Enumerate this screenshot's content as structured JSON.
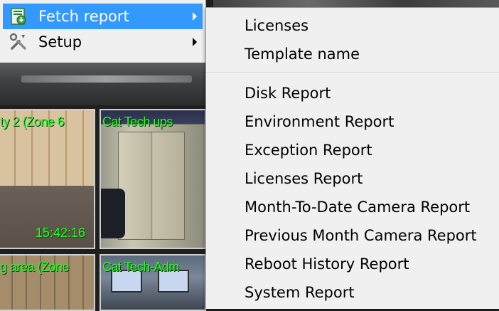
{
  "parent_menu": {
    "items": [
      {
        "label": "Fetch report",
        "icon": "report-download-icon",
        "active": true,
        "has_submenu": true
      },
      {
        "label": "Setup",
        "icon": "tools-icon",
        "active": false,
        "has_submenu": true
      }
    ]
  },
  "submenu": {
    "group1": [
      "Licenses",
      "Template name"
    ],
    "group2": [
      "Disk Report",
      "Environment Report",
      "Exception Report",
      "Licenses Report",
      "Month-To-Date Camera Report",
      "Previous Month Camera Report",
      "Reboot History Report",
      "System Report"
    ]
  },
  "camera_tiles": [
    {
      "label": "ty 2 (Zone 6"
    },
    {
      "label": "Cat Tech ups"
    },
    {
      "label": "g area (Zone"
    },
    {
      "label": "Cat Tech-Adm"
    }
  ],
  "camera_time": "15:42:16",
  "colors": {
    "highlight": "#3399ff",
    "menu_bg": "#f0f0f0",
    "overlay_text": "#22ff22"
  }
}
